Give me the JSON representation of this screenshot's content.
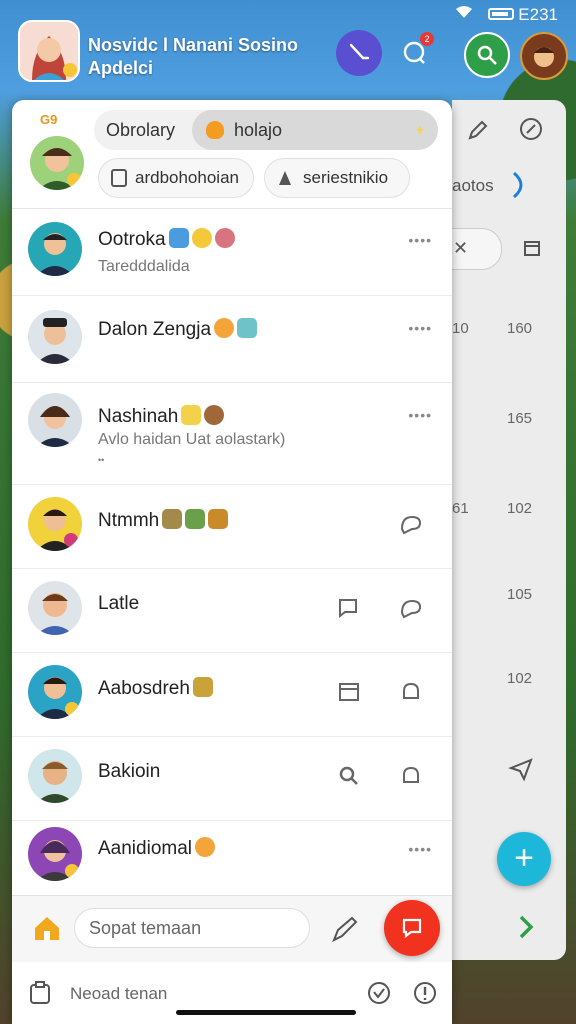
{
  "status": {
    "time": "E231"
  },
  "header": {
    "title_line1": "Nosvidc l Nanani Sosino",
    "title_line2": "Apdelci",
    "notif_badge": "2"
  },
  "panel": {
    "profile_badge": "G9",
    "chips": {
      "obrolary": "Obrolary",
      "holajo": "holajo",
      "ardbohohoian": "ardbohohoian",
      "seriestnikio": "seriestnikio"
    },
    "rows": [
      {
        "name": "Ootroka",
        "sub": "Taredddalida",
        "more": "••••"
      },
      {
        "name": "Dalon Zengja",
        "more": "••••"
      },
      {
        "name": "Nashinah",
        "sub": "Avlo haidan  Uat aolastark)",
        "sub2": "••",
        "more": "••••"
      },
      {
        "name": "Ntmmh"
      },
      {
        "name": "Latle"
      },
      {
        "name": "Aabosdreh"
      },
      {
        "name": "Bakioin"
      },
      {
        "name": "Aanidiomal",
        "more": "••••"
      }
    ],
    "search_placeholder": "Sopat temaan",
    "bottom_input": "Neoad tenan"
  },
  "side": {
    "tab_label": "aotos",
    "numbers": [
      {
        "left": "10",
        "right": "160"
      },
      {
        "left": "",
        "right": "165"
      },
      {
        "left": "61",
        "right": "102"
      },
      {
        "left": "",
        "right": "105"
      },
      {
        "left": "",
        "right": "102"
      }
    ]
  },
  "colors": {
    "accent_purple": "#5b4fd1",
    "accent_green": "#2e9e48",
    "fab_blue": "#1db7d9",
    "fab_red": "#f0321e",
    "send_green": "#2e9e48"
  }
}
